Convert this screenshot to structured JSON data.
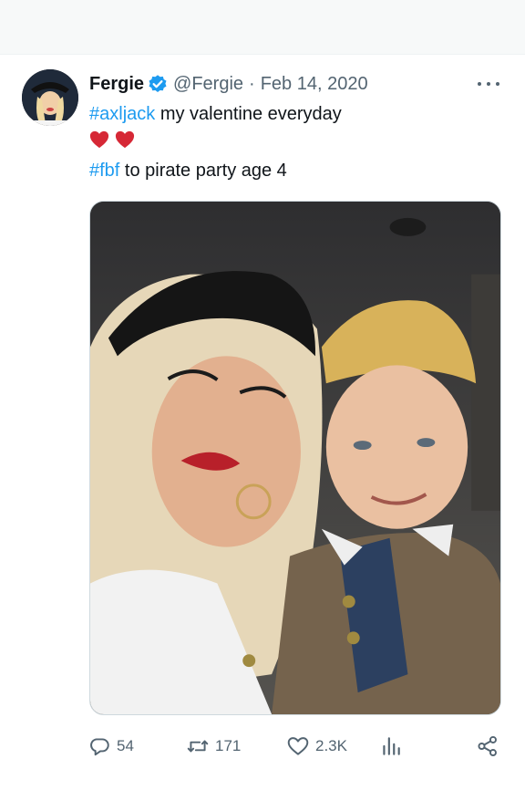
{
  "tweet": {
    "author_name": "Fergie",
    "handle": "@Fergie",
    "separator": "·",
    "date": "Feb 14, 2020",
    "line1_hashtag": "#axljack",
    "line1_text": " my valentine everyday",
    "line3_hashtag": "#fbf",
    "line3_text": " to pirate party age 4"
  },
  "actions": {
    "replies": "54",
    "retweets": "171",
    "likes": "2.3K"
  },
  "colors": {
    "accent": "#1d9bf0",
    "secondary_text": "#536471",
    "heart": "#d62836"
  },
  "icons": {
    "verified": "verified-badge-icon",
    "more": "more-options-icon",
    "heart": "heart-emoji-icon",
    "reply": "reply-icon",
    "retweet": "retweet-icon",
    "like": "like-icon",
    "views": "views-icon",
    "share": "share-icon"
  }
}
